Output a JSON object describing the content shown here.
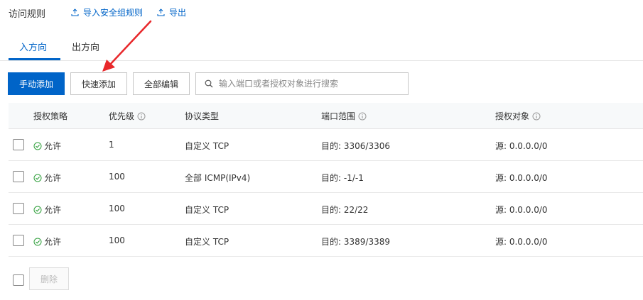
{
  "header": {
    "title": "访问规则",
    "import_label": "导入安全组规则",
    "export_label": "导出"
  },
  "tabs": [
    {
      "label": "入方向",
      "active": true
    },
    {
      "label": "出方向",
      "active": false
    }
  ],
  "toolbar": {
    "manual_add_label": "手动添加",
    "quick_add_label": "快速添加",
    "edit_all_label": "全部编辑",
    "search_placeholder": "输入端口或者授权对象进行搜索"
  },
  "table": {
    "columns": [
      "授权策略",
      "优先级",
      "协议类型",
      "端口范围",
      "授权对象"
    ],
    "rows": [
      {
        "policy": "允许",
        "priority": "1",
        "protocol": "自定义 TCP",
        "port": "目的: 3306/3306",
        "source": "源: 0.0.0.0/0"
      },
      {
        "policy": "允许",
        "priority": "100",
        "protocol": "全部 ICMP(IPv4)",
        "port": "目的: -1/-1",
        "source": "源: 0.0.0.0/0"
      },
      {
        "policy": "允许",
        "priority": "100",
        "protocol": "自定义 TCP",
        "port": "目的: 22/22",
        "source": "源: 0.0.0.0/0"
      },
      {
        "policy": "允许",
        "priority": "100",
        "protocol": "自定义 TCP",
        "port": "目的: 3389/3389",
        "source": "源: 0.0.0.0/0"
      }
    ]
  },
  "footer": {
    "delete_label": "删除"
  },
  "colors": {
    "accent": "#0064c8",
    "allow_green": "#2e9e3a",
    "annotation_arrow": "#e8282b"
  },
  "icons": {
    "import": "upload-icon",
    "export": "upload-icon",
    "search": "search-icon",
    "info": "info-circle-icon",
    "allow": "check-circle-icon"
  }
}
